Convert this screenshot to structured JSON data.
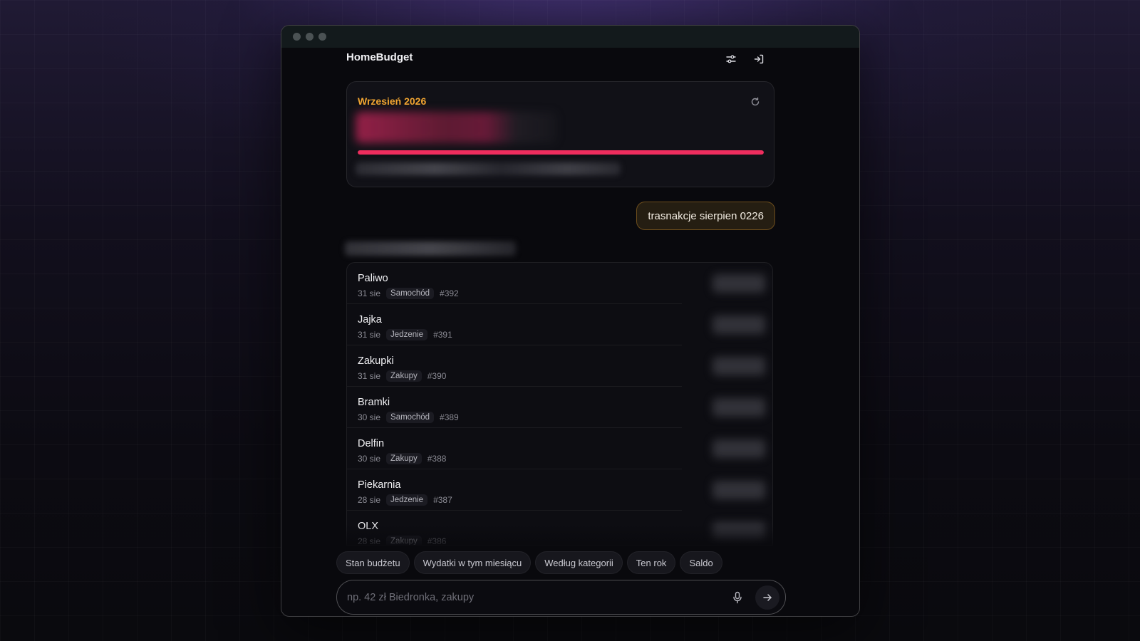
{
  "app": {
    "brand": "HomeBudget",
    "colors": {
      "accent": "#f2a531",
      "progress": "#ef2d5e",
      "background": "#09090d"
    },
    "header_icons": [
      "settings-sliders-icon",
      "logout-icon"
    ]
  },
  "budget_card": {
    "month": "Wrzesień 2026",
    "progress_fraction": 1.0,
    "refresh_icon": "refresh-icon"
  },
  "chat": {
    "user_message": "trasnakcje sierpien 0226"
  },
  "transactions": [
    {
      "name": "Paliwo",
      "date": "31 sie",
      "category": "Samochód",
      "id": "#392"
    },
    {
      "name": "Jajka",
      "date": "31 sie",
      "category": "Jedzenie",
      "id": "#391"
    },
    {
      "name": "Zakupki",
      "date": "31 sie",
      "category": "Zakupy",
      "id": "#390"
    },
    {
      "name": "Bramki",
      "date": "30 sie",
      "category": "Samochód",
      "id": "#389"
    },
    {
      "name": "Delfin",
      "date": "30 sie",
      "category": "Zakupy",
      "id": "#388"
    },
    {
      "name": "Piekarnia",
      "date": "28 sie",
      "category": "Jedzenie",
      "id": "#387"
    },
    {
      "name": "OLX",
      "date": "28 sie",
      "category": "Zakupy",
      "id": "#386"
    }
  ],
  "quick_actions": [
    "Stan budżetu",
    "Wydatki w tym miesiącu",
    "Według kategorii",
    "Ten rok",
    "Saldo"
  ],
  "composer": {
    "placeholder": "np. 42 zł Biedronka, zakupy",
    "value": "",
    "mic_icon": "microphone-icon",
    "send_icon": "arrow-right-icon"
  }
}
